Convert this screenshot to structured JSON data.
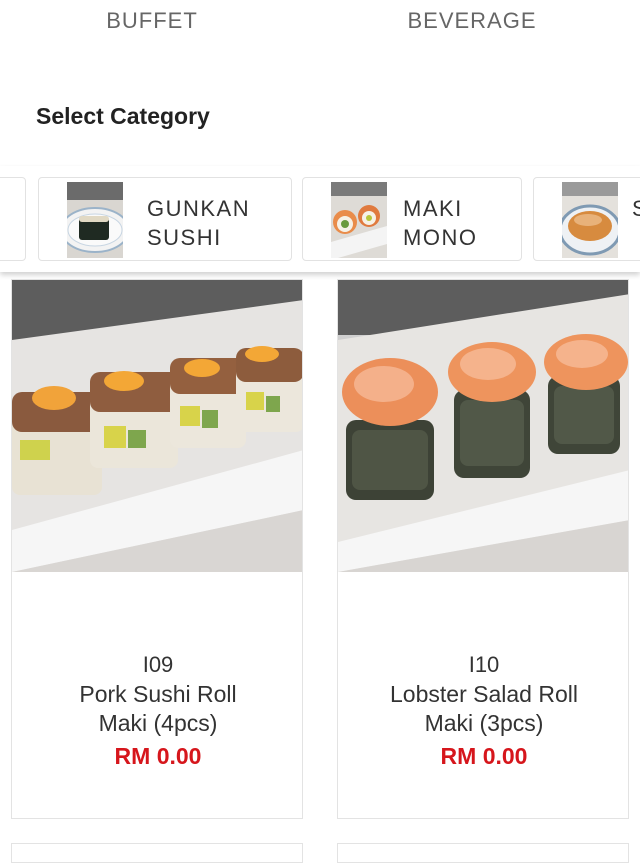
{
  "tabs": [
    {
      "label": "BUFFET"
    },
    {
      "label": "BEVERAGE"
    }
  ],
  "section_title": "Select Category",
  "categories": [
    {
      "label": "GUNKAN\nSUSHI"
    },
    {
      "label": "MAKI\nMONO"
    },
    {
      "label": "S"
    }
  ],
  "products": [
    {
      "code": "I09",
      "name": "Pork Sushi Roll\nMaki (4pcs)",
      "price": "RM 0.00"
    },
    {
      "code": "I10",
      "name": "Lobster Salad Roll\nMaki (3pcs)",
      "price": "RM 0.00"
    }
  ],
  "colors": {
    "price": "#d6161c",
    "text": "#333333",
    "border": "#e3e3e3"
  }
}
